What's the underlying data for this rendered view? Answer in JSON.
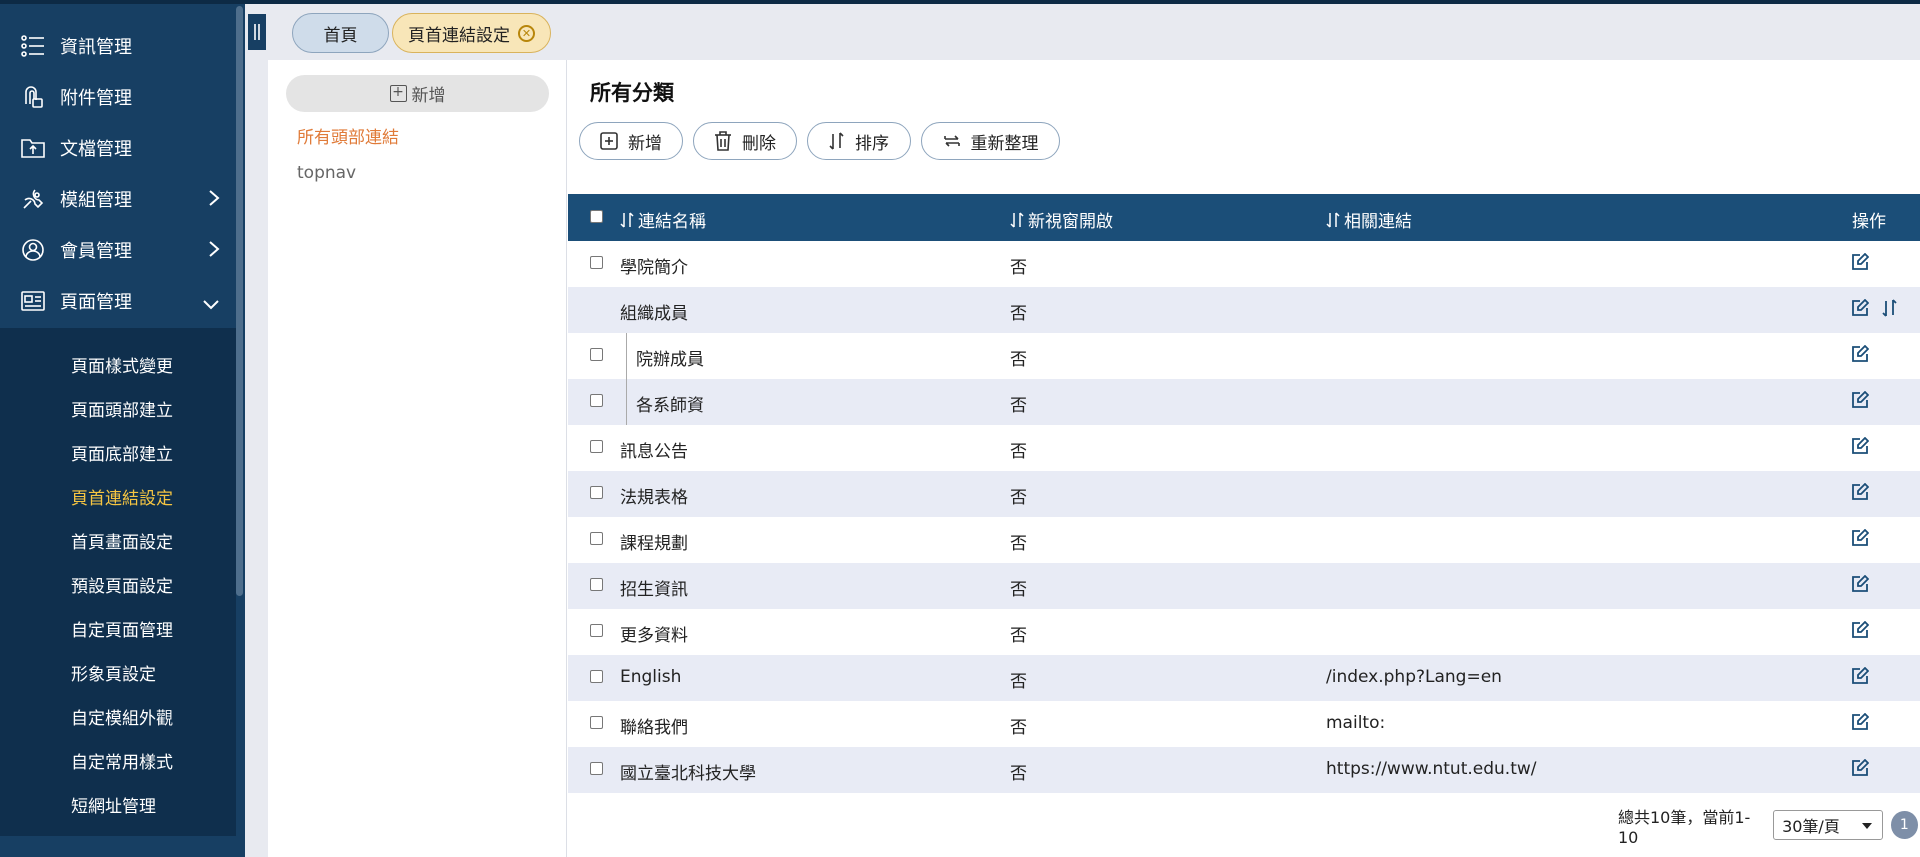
{
  "sidebar": {
    "items": [
      {
        "label": "資訊管理",
        "icon": "list-icon"
      },
      {
        "label": "附件管理",
        "icon": "attachment-icon"
      },
      {
        "label": "文檔管理",
        "icon": "folder-upload-icon"
      },
      {
        "label": "模組管理",
        "icon": "wrench-icon"
      },
      {
        "label": "會員管理",
        "icon": "user-icon"
      },
      {
        "label": "頁面管理",
        "icon": "page-layout-icon"
      }
    ],
    "subitems": [
      {
        "label": "頁面樣式變更"
      },
      {
        "label": "頁面頭部建立"
      },
      {
        "label": "頁面底部建立"
      },
      {
        "label": "頁首連結設定",
        "active": true
      },
      {
        "label": "首頁畫面設定"
      },
      {
        "label": "預設頁面設定"
      },
      {
        "label": "自定頁面管理"
      },
      {
        "label": "形象頁設定"
      },
      {
        "label": "自定模組外觀"
      },
      {
        "label": "自定常用樣式"
      },
      {
        "label": "短網址管理"
      }
    ]
  },
  "tabs": {
    "home": "首頁",
    "current": "頁首連結設定"
  },
  "categories": {
    "add_label": "新增",
    "items": [
      "所有頭部連結",
      "topnav"
    ]
  },
  "main": {
    "title": "所有分類",
    "toolbar": {
      "add": "新增",
      "delete": "刪除",
      "sort": "排序",
      "reorganize": "重新整理"
    },
    "columns": {
      "name": "連結名稱",
      "new_window": "新視窗開啟",
      "link": "相關連結",
      "actions": "操作"
    },
    "rows": [
      {
        "name": "學院簡介",
        "new_window": "否",
        "link": ""
      },
      {
        "name": "組織成員",
        "new_window": "否",
        "link": ""
      },
      {
        "name": "院辦成員",
        "new_window": "否",
        "link": ""
      },
      {
        "name": "各系師資",
        "new_window": "否",
        "link": ""
      },
      {
        "name": "訊息公告",
        "new_window": "否",
        "link": ""
      },
      {
        "name": "法規表格",
        "new_window": "否",
        "link": ""
      },
      {
        "name": "課程規劃",
        "new_window": "否",
        "link": ""
      },
      {
        "name": "招生資訊",
        "new_window": "否",
        "link": ""
      },
      {
        "name": "更多資料",
        "new_window": "否",
        "link": ""
      },
      {
        "name": "English",
        "new_window": "否",
        "link": "/index.php?Lang=en"
      },
      {
        "name": "聯絡我們",
        "new_window": "否",
        "link": "mailto:"
      },
      {
        "name": "國立臺北科技大學",
        "new_window": "否",
        "link": "https://www.ntut.edu.tw/"
      }
    ],
    "footer": {
      "summary": "總共10筆，當前1-10",
      "page_size": "30筆/頁",
      "page": "1"
    }
  },
  "colors": {
    "sidebar_bg": "#173f63",
    "header_bg": "#1b4e78",
    "active_submenu": "#f5c542",
    "active_category": "#e07b39"
  }
}
